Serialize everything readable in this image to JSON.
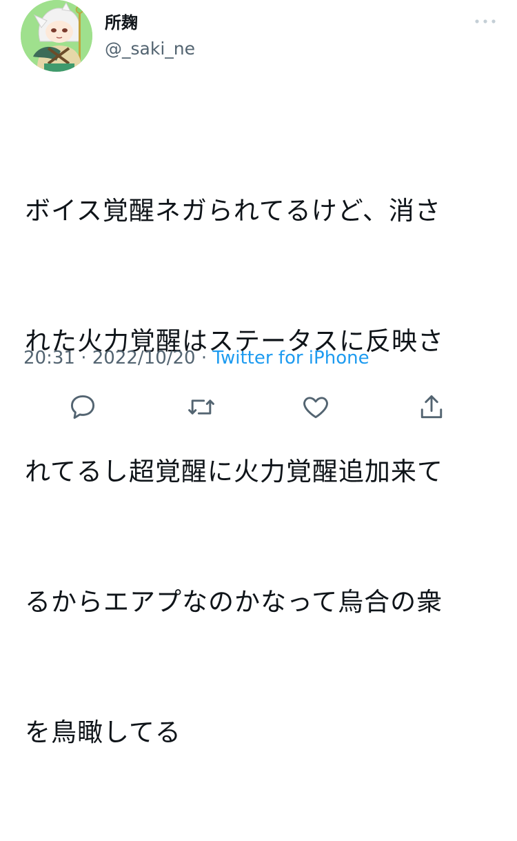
{
  "user": {
    "display_name": "所麹",
    "handle": "@_saki_ne"
  },
  "tweet": {
    "lines": [
      "ボイス覚醒ネガられてるけど、消さ",
      "れた火力覚醒はステータスに反映さ",
      "れてるし超覚醒に火力覚醒追加来て",
      "るからエアプなのかなって烏合の衆",
      "を鳥瞰してる"
    ],
    "time": "20:31",
    "separator": "·",
    "date": "2022/10/20",
    "source": "Twitter for iPhone"
  },
  "icons": {
    "more": "more-horizontal-icon",
    "reply": "reply-icon",
    "retweet": "retweet-icon",
    "like": "like-icon",
    "share": "share-icon"
  },
  "colors": {
    "link": "#1d9bf0",
    "secondary": "#536471",
    "icon": "#536471",
    "avatar_bg": "#9fe08d"
  }
}
